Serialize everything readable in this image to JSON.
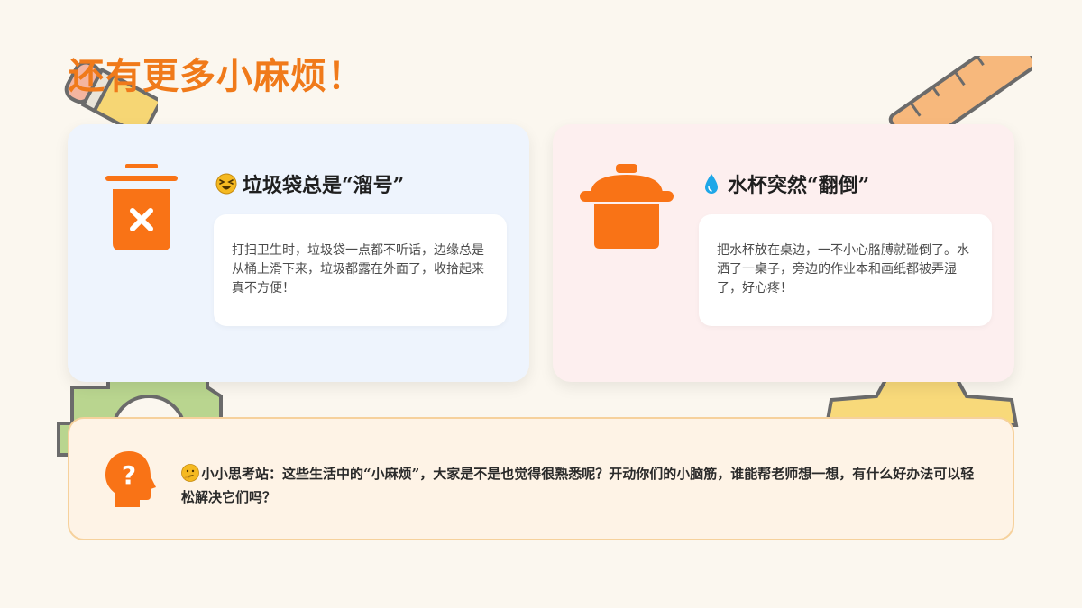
{
  "title": {
    "text": "还有更多小麻烦！",
    "color": "#f07a1a"
  },
  "cards": [
    {
      "heading": "垃圾袋总是“溜号”",
      "emoji_icon": "tired-face-icon",
      "main_icon": "trash-bin-icon",
      "description": "打扫卫生时，垃圾袋一点都不听话，边缘总是从桶上滑下来，垃圾都露在外面了，收拾起来真不方便！"
    },
    {
      "heading": "水杯突然“翻倒”",
      "emoji_icon": "water-drop-icon",
      "main_icon": "pot-icon",
      "description": "把水杯放在桌边，一不小心胳膊就碰倒了。水洒了一桌子，旁边的作业本和画纸都被弄湿了，好心疼！"
    }
  ],
  "think": {
    "icon": "head-question-icon",
    "emoji_icon": "thinking-face-icon",
    "text": "小小思考站：这些生活中的“小麻烦”，大家是不是也觉得很熟悉呢？开动你们的小脑筋，谁能帮老师想一想，有什么好办法可以轻松解决它们吗？"
  },
  "colors": {
    "accent": "#f07a1a",
    "icon_orange": "#f97316"
  }
}
